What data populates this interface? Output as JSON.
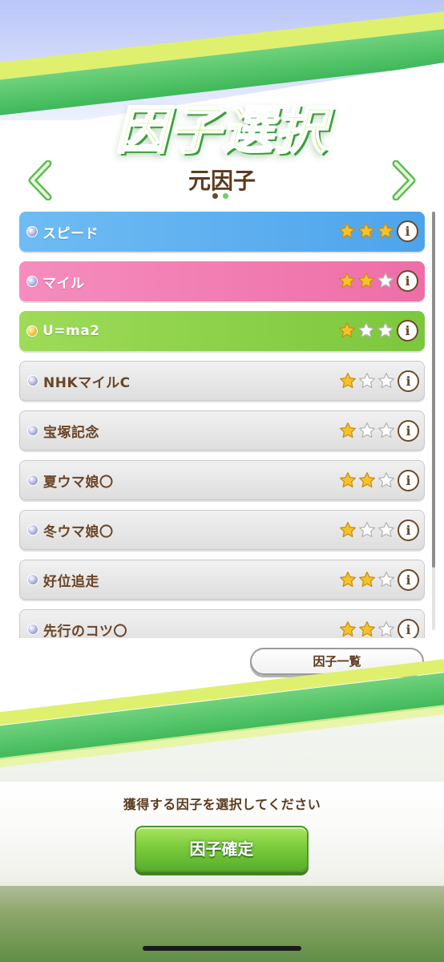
{
  "header": {
    "title": "因子選択",
    "section_title": "元因子",
    "page_count": 2,
    "current_page": 1
  },
  "factors": [
    {
      "name": "スピード",
      "color": "blue",
      "gem": "silver",
      "stars": 3
    },
    {
      "name": "マイル",
      "color": "pink",
      "gem": "silver",
      "stars": 2
    },
    {
      "name": "U=ma2",
      "color": "green",
      "gem": "gold",
      "stars": 1
    },
    {
      "name": "NHKマイルC",
      "color": "gray",
      "gem": "silver",
      "stars": 1
    },
    {
      "name": "宝塚記念",
      "color": "gray",
      "gem": "silver",
      "stars": 1
    },
    {
      "name": "夏ウマ娘〇",
      "color": "gray",
      "gem": "silver",
      "stars": 2
    },
    {
      "name": "冬ウマ娘〇",
      "color": "gray",
      "gem": "silver",
      "stars": 1
    },
    {
      "name": "好位追走",
      "color": "gray",
      "gem": "silver",
      "stars": 2
    },
    {
      "name": "先行のコツ〇",
      "color": "gray",
      "gem": "silver",
      "stars": 2
    }
  ],
  "max_stars": 3,
  "info_icon_glyph": "i",
  "factor_list_button": "因子一覧",
  "instruction": "獲得する因子を選択してください",
  "confirm_button": "因子確定",
  "colors": {
    "brown_text": "#5a3b1f",
    "accent_green": "#78c93a",
    "star_filled": "#f5c22b",
    "star_empty": "#ffffff"
  }
}
